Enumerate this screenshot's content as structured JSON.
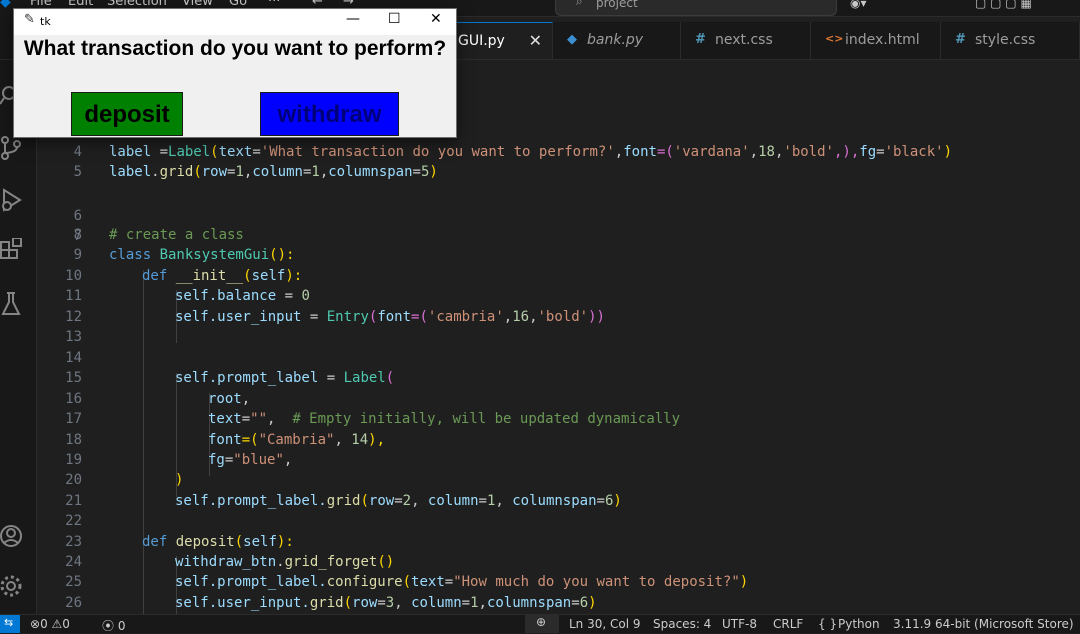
{
  "menu": {
    "file": "File",
    "edit": "Edit",
    "selection": "Selection",
    "view": "View",
    "go": "Go",
    "more": "···",
    "back": "←",
    "forward": "→"
  },
  "search": {
    "text": "project"
  },
  "tabs": [
    {
      "icon": "",
      "label": "GUI.py",
      "close": "✕"
    },
    {
      "icon": "◆",
      "label": "bank.py"
    },
    {
      "icon": "#",
      "label": "next.css"
    },
    {
      "icon": "<>",
      "label": "index.html"
    },
    {
      "icon": "#",
      "label": "style.css"
    }
  ],
  "colors": {
    "accent": "#0078d4",
    "deposit_bg": "#008000",
    "withdraw_bg": "#0000ff",
    "withdraw_fg": "#000080"
  },
  "code": {
    "l4": {
      "n": "4",
      "p1": "label ",
      "p2": "=",
      "p3": "Label",
      "p4": "(",
      "p5": "text",
      "p6": "=",
      "p7": "'What transaction do you want to perform?'",
      "p8": ",",
      "p9": "font",
      "p10": "=(",
      "p11": "'vardana'",
      "p12": ",",
      "p13": "18",
      "p14": ",",
      "p15": "'bold'",
      "p16": ",),",
      "p17": "fg",
      "p18": "=",
      "p19": "'black'",
      "p20": ")"
    },
    "l5": {
      "n": "5",
      "p1": "label",
      "p2": ".",
      "p3": "grid",
      "p4": "(",
      "p5": "row",
      "p6": "=",
      "p7": "1",
      "p8": ",",
      "p9": "column",
      "p10": "=",
      "p11": "1",
      "p12": ",",
      "p13": "columnspan",
      "p14": "=",
      "p15": "5",
      "p16": ")"
    },
    "l6": {
      "n": "6"
    },
    "l7": {
      "n": "7"
    },
    "l8": {
      "n": "8",
      "text": "# create a class"
    },
    "l9": {
      "n": "9",
      "p1": "class ",
      "p2": "BanksystemGui",
      "p3": "():"
    },
    "l10": {
      "n": "10",
      "p1": "def ",
      "p2": "__init__",
      "p3": "(",
      "p4": "self",
      "p5": "):"
    },
    "l11": {
      "n": "11",
      "p1": "self",
      "p2": ".balance ",
      "p3": "= ",
      "p4": "0"
    },
    "l12": {
      "n": "12",
      "p1": "self",
      "p2": ".user_input ",
      "p3": "= ",
      "p4": "Entry",
      "p5": "(",
      "p6": "font",
      "p7": "=(",
      "p8": "'cambria'",
      "p9": ",",
      "p10": "16",
      "p11": ",",
      "p12": "'bold'",
      "p13": "))"
    },
    "l13": {
      "n": "13"
    },
    "l14": {
      "n": "14"
    },
    "l15": {
      "n": "15",
      "p1": "self",
      "p2": ".prompt_label ",
      "p3": "= ",
      "p4": "Label",
      "p5": "("
    },
    "l16": {
      "n": "16",
      "p1": "root",
      "p2": ","
    },
    "l17": {
      "n": "17",
      "p1": "text",
      "p2": "=",
      "p3": "\"\"",
      "p4": ",  ",
      "p5": "# Empty initially, will be updated dynamically"
    },
    "l18": {
      "n": "18",
      "p1": "font",
      "p2": "=(",
      "p3": "\"Cambria\"",
      "p4": ", ",
      "p5": "14",
      "p6": "),"
    },
    "l19": {
      "n": "19",
      "p1": "fg",
      "p2": "=",
      "p3": "\"blue\"",
      "p4": ","
    },
    "l20": {
      "n": "20",
      "p1": ")"
    },
    "l21": {
      "n": "21",
      "p1": "self",
      "p2": ".prompt_label.",
      "p3": "grid",
      "p4": "(",
      "p5": "row",
      "p6": "=",
      "p7": "2",
      "p8": ", ",
      "p9": "column",
      "p10": "=",
      "p11": "1",
      "p12": ", ",
      "p13": "columnspan",
      "p14": "=",
      "p15": "6",
      "p16": ")"
    },
    "l22": {
      "n": "22"
    },
    "l23": {
      "n": "23",
      "p1": "def ",
      "p2": "deposit",
      "p3": "(",
      "p4": "self",
      "p5": "):"
    },
    "l24": {
      "n": "24",
      "p1": "withdraw_btn",
      "p2": ".",
      "p3": "grid_forget",
      "p4": "()"
    },
    "l25": {
      "n": "25",
      "p1": "self",
      "p2": ".prompt_label.",
      "p3": "configure",
      "p4": "(",
      "p5": "text",
      "p6": "=",
      "p7": "\"How much do you want to deposit?\"",
      "p8": ")"
    },
    "l26": {
      "n": "26",
      "p1": "self",
      "p2": ".user_input.",
      "p3": "grid",
      "p4": "(",
      "p5": "row",
      "p6": "=",
      "p7": "3",
      "p8": ", ",
      "p9": "column",
      "p10": "=",
      "p11": "1",
      "p12": ",",
      "p13": "columnspan",
      "p14": "=",
      "p15": "6",
      "p16": ")"
    }
  },
  "status": {
    "errors": "0",
    "warnings": "0",
    "ports": "0",
    "position": "Ln 30, Col 9",
    "spaces": "Spaces: 4",
    "encoding": "UTF-8",
    "eol": "CRLF",
    "language": "Python",
    "interpreter": "3.11.9 64-bit (Microsoft Store)",
    "braces": "{ }"
  },
  "tk": {
    "title": "tk",
    "question": "What transaction do you want to perform?",
    "deposit": "deposit",
    "withdraw": "withdraw",
    "minimize": "—",
    "maximize": "☐",
    "close": "✕"
  }
}
